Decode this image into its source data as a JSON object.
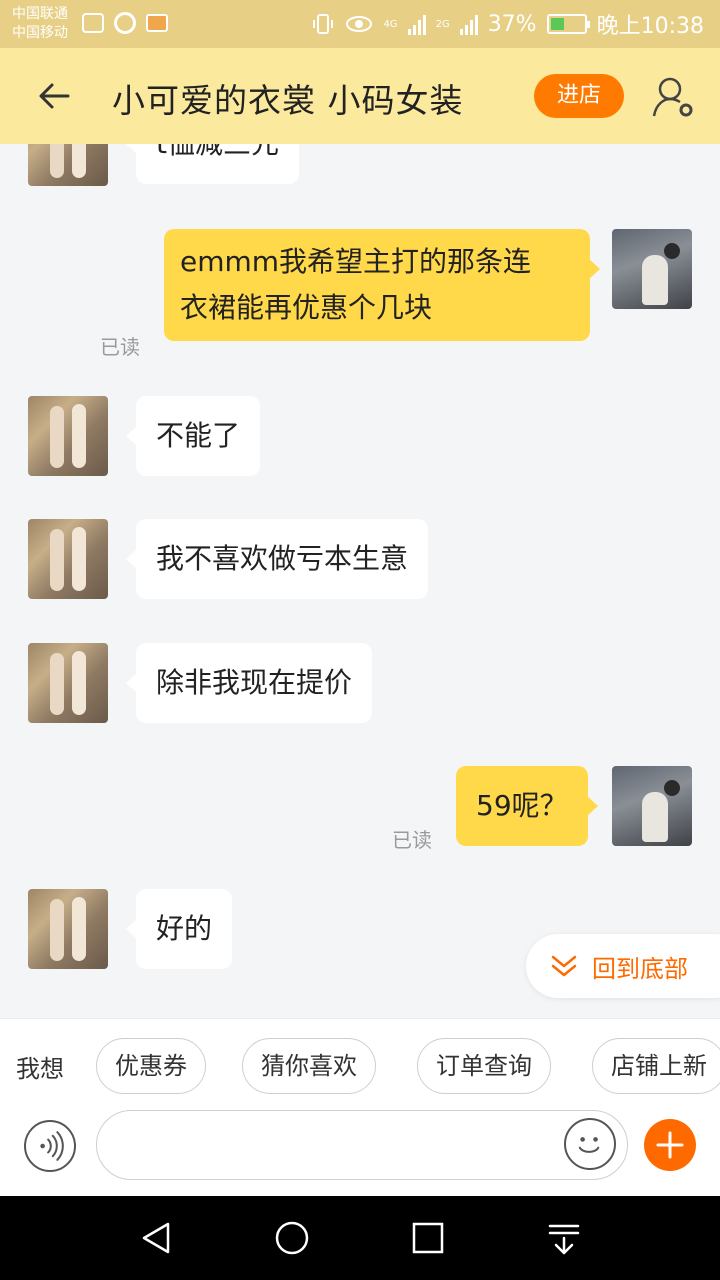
{
  "status_bar": {
    "carrier_1": "中国联通",
    "carrier_2": "中国移动",
    "net_1": "4G",
    "net_2": "2G",
    "battery": "37%",
    "time": "晚上10:38"
  },
  "header": {
    "title": "小可爱的衣裳  小码女装",
    "enter_store": "进店"
  },
  "messages": [
    {
      "from": "shop",
      "text": "t恤减三元"
    },
    {
      "from": "me",
      "lines": [
        "emmm我希望主打的那条连",
        "衣裙能再优惠个几块"
      ],
      "status": "已读"
    },
    {
      "from": "shop",
      "text": "不能了"
    },
    {
      "from": "shop",
      "text": "我不喜欢做亏本生意"
    },
    {
      "from": "shop",
      "text": "除非我现在提价"
    },
    {
      "from": "me",
      "text": "59呢？",
      "status": "已读"
    },
    {
      "from": "shop",
      "text": "好的"
    }
  ],
  "back_to_bottom": "回到底部",
  "quick_bar": {
    "label": "我想",
    "chips": [
      "优惠券",
      "猜你喜欢",
      "订单查询",
      "店铺上新"
    ]
  },
  "input": {
    "value": ""
  },
  "colors": {
    "accent": "#ff6a00",
    "header_bg": "#fbe99e",
    "out_bubble": "#ffd94a"
  }
}
